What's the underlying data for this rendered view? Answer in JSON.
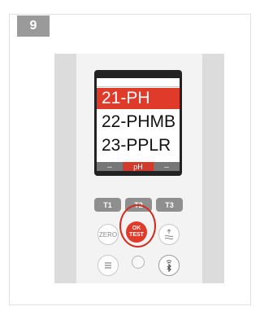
{
  "step": {
    "number": "9"
  },
  "display": {
    "menu_items": [
      "21-PH",
      "22-PHMB",
      "23-PPLR"
    ],
    "selected_index": 0,
    "softkeys": [
      "--",
      "pH",
      "--"
    ]
  },
  "buttons": {
    "t1": "T1",
    "t2": "T2",
    "t3": "T3",
    "zero": "ZERO",
    "ok_line1": "OK",
    "ok_line2": "TEST"
  },
  "colors": {
    "accent": "#e03a2a",
    "highlight": "#d42a1e"
  }
}
